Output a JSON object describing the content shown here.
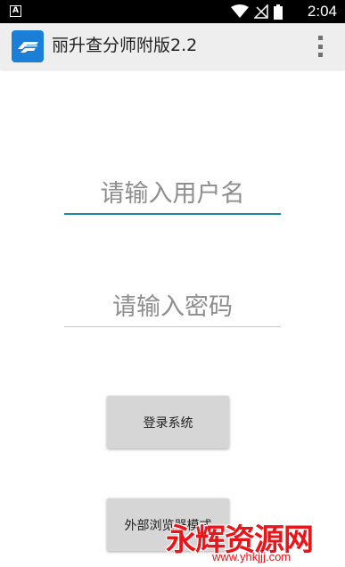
{
  "status_bar": {
    "notification_icon": "A",
    "time": "2:04",
    "icons": [
      "wifi-icon",
      "no-signal-icon",
      "battery-icon"
    ]
  },
  "action_bar": {
    "title": "丽升查分师附版2.2",
    "app_icon": "app-logo-icon",
    "menu_icon": "overflow-menu-icon"
  },
  "form": {
    "username": {
      "value": "",
      "placeholder": "请输入用户名"
    },
    "password": {
      "value": "",
      "placeholder": "请输入密码"
    }
  },
  "buttons": {
    "login_label": "登录系统",
    "other_label": "外部浏览器模式"
  },
  "watermark": {
    "text": "永辉资源网",
    "url": "www.yhkjjj.com"
  },
  "colors": {
    "status_bar": "#000000",
    "action_bar": "#eeeeee",
    "accent": "#1e88a8",
    "button": "#d6d6d6",
    "watermark": "#e8161b"
  }
}
